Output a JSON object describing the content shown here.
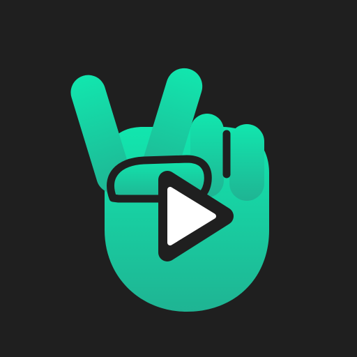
{
  "icon": {
    "name": "peace-hand-play-icon",
    "colors": {
      "background": "#1f1f1f",
      "gradient_top": "#12e6ae",
      "gradient_bottom": "#1fb493",
      "outline": "#1f1f1f",
      "play_fill": "#ffffff"
    }
  }
}
